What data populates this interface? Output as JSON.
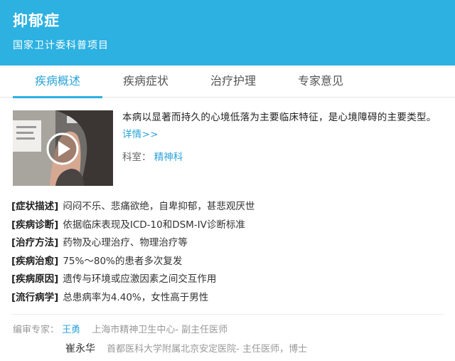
{
  "header": {
    "title": "抑郁症",
    "subtitle": "国家卫计委科普项目",
    "bg_color": "#2cb1e1"
  },
  "tabs": [
    {
      "label": "疾病概述",
      "active": true
    },
    {
      "label": "疾病症状",
      "active": false
    },
    {
      "label": "治疗护理",
      "active": false
    },
    {
      "label": "专家意见",
      "active": false
    }
  ],
  "intro": {
    "text": "本病以显著而持久的心境低落为主要临床特征，是心境障碍的主要类型。",
    "more_link": "详情>>",
    "dept_label": "科室：",
    "dept_value": "精神科"
  },
  "video": {
    "icon": "play-icon"
  },
  "facts": [
    {
      "key": "[症状描述]",
      "value": "闷闷不乐、悲痛欲绝，自卑抑郁，甚悲观厌世"
    },
    {
      "key": "[疾病诊断]",
      "value": "依据临床表现及ICD-10和DSM-IV诊断标准"
    },
    {
      "key": "[治疗方法]",
      "value": "药物及心理治疗、物理治疗等"
    },
    {
      "key": "[疾病治愈]",
      "value": "75%～80%的患者多次复发"
    },
    {
      "key": "[疾病原因]",
      "value": "遗传与环境或应激因素之间交互作用"
    },
    {
      "key": "[流行病学]",
      "value": "总患病率为4.40%，女性高于男性"
    }
  ],
  "experts": {
    "label": "编审专家：",
    "list": [
      {
        "name": "王勇",
        "title": "上海市精神卫生中心- 副主任医师"
      },
      {
        "name": "崔永华",
        "title": "首都医科大学附属北京安定医院- 主任医师，博士"
      }
    ]
  },
  "colors": {
    "accent": "#2aa3d8"
  }
}
